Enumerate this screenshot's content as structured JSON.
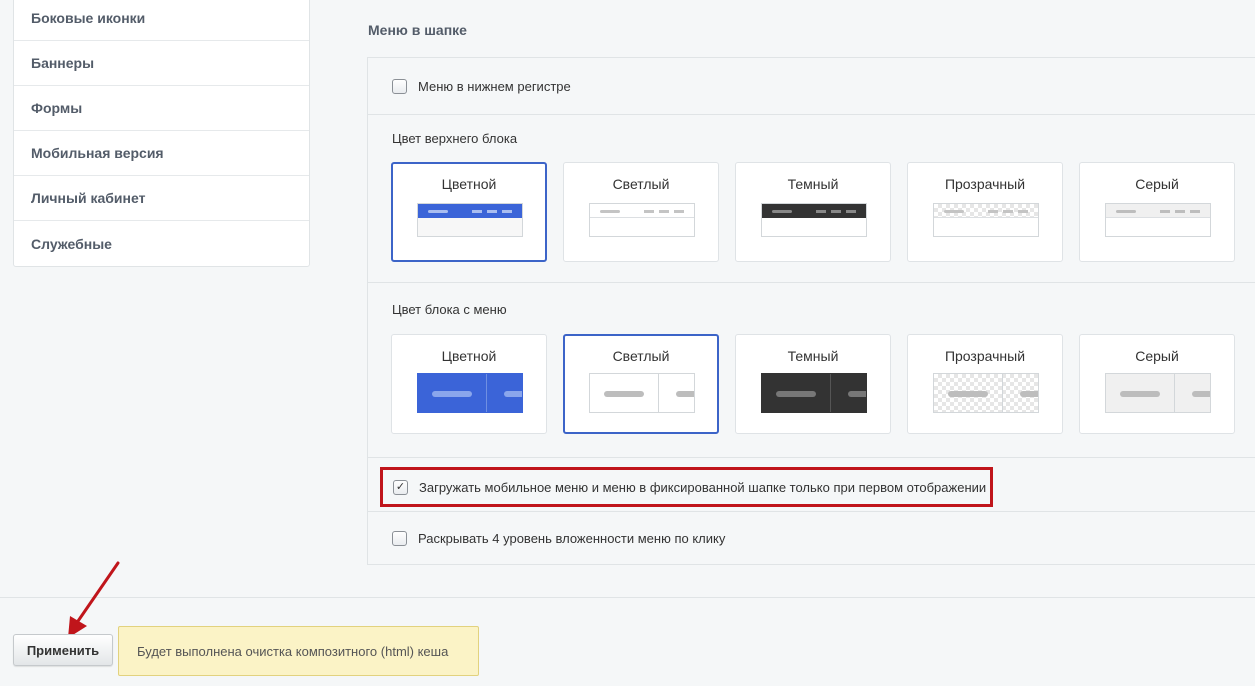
{
  "sidebar": {
    "items": [
      {
        "label": "Боковые иконки"
      },
      {
        "label": "Баннеры"
      },
      {
        "label": "Формы"
      },
      {
        "label": "Мобильная версия"
      },
      {
        "label": "Личный кабинет"
      },
      {
        "label": "Служебные"
      }
    ]
  },
  "main": {
    "section_title": "Меню в шапке",
    "lowercase_menu": {
      "label": "Меню в нижнем регистре",
      "checked": false
    },
    "top_block": {
      "label": "Цвет верхнего блока",
      "selected": "Цветной",
      "options": [
        {
          "label": "Цветной",
          "color": "#3b64d8"
        },
        {
          "label": "Светлый",
          "color": "#ffffff"
        },
        {
          "label": "Темный",
          "color": "#333333"
        },
        {
          "label": "Прозрачный",
          "color": "transparent"
        },
        {
          "label": "Серый",
          "color": "#f0f0f0"
        }
      ]
    },
    "menu_block": {
      "label": "Цвет блока с меню",
      "selected": "Светлый",
      "options": [
        {
          "label": "Цветной",
          "color": "#3b64d8"
        },
        {
          "label": "Светлый",
          "color": "#ffffff"
        },
        {
          "label": "Темный",
          "color": "#333333"
        },
        {
          "label": "Прозрачный",
          "color": "transparent"
        },
        {
          "label": "Серый",
          "color": "#f0f0f0"
        }
      ]
    },
    "lazy_load": {
      "label": "Загружать мобильное меню и меню в фиксированной шапке только при первом отображении",
      "checked": true
    },
    "expand_level4": {
      "label": "Раскрывать 4 уровень вложенности меню по клику",
      "checked": false
    }
  },
  "footer": {
    "apply_label": "Применить",
    "notice": "Будет выполнена очистка композитного (html) кеша"
  },
  "colors": {
    "accent": "#3c64c8",
    "highlight_border": "#c0151b",
    "arrow": "#c0151b",
    "notice_bg": "#fbf3c6"
  }
}
